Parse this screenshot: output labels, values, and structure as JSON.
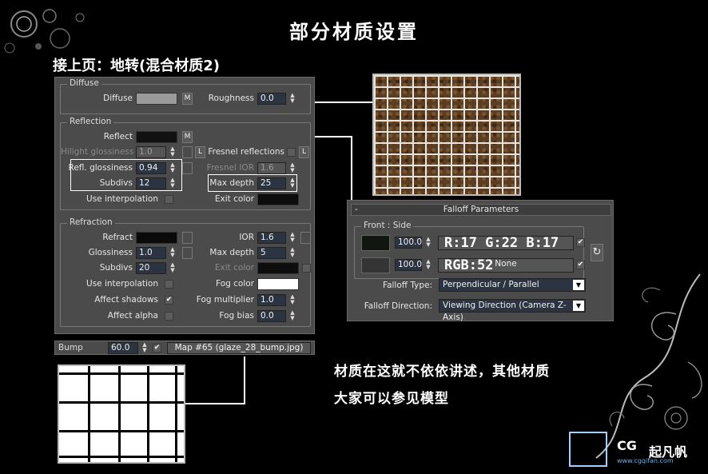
{
  "slide": {
    "title": "部分材质设置",
    "subtitle": "接上页：地转(混合材质2)"
  },
  "diffuse": {
    "group": "Diffuse",
    "diffuse_label": "Diffuse",
    "m_button": "M",
    "roughness_label": "Roughness",
    "roughness_value": "0.0"
  },
  "reflection": {
    "group": "Reflection",
    "reflect_label": "Reflect",
    "m_button": "M",
    "hilight_label": "Hilight glossiness",
    "hilight_value": "1.0",
    "l_button": "L",
    "fresnel_label": "Fresnel reflections",
    "fresnel_l": "L",
    "refl_gloss_label": "Refl. glossiness",
    "refl_gloss_value": "0.94",
    "fresnel_ior_label": "Fresnel IOR",
    "fresnel_ior_value": "1.6",
    "subdivs_label": "Subdivs",
    "subdivs_value": "12",
    "max_depth_label": "Max depth",
    "max_depth_value": "25",
    "use_interp_label": "Use interpolation",
    "exit_color_label": "Exit color"
  },
  "refraction": {
    "group": "Refraction",
    "refract_label": "Refract",
    "ior_label": "IOR",
    "ior_value": "1.6",
    "glossiness_label": "Glossiness",
    "glossiness_value": "1.0",
    "max_depth_label": "Max depth",
    "max_depth_value": "5",
    "subdivs_label": "Subdivs",
    "subdivs_value": "20",
    "exit_color_label": "Exit color",
    "use_interp_label": "Use interpolation",
    "fog_color_label": "Fog color",
    "affect_shadows_label": "Affect shadows",
    "affect_shadows_check": "✔",
    "fog_mult_label": "Fog multiplier",
    "fog_mult_value": "1.0",
    "affect_alpha_label": "Affect alpha",
    "fog_bias_label": "Fog bias",
    "fog_bias_value": "0.0"
  },
  "bump": {
    "label": "Bump",
    "value": "60.0",
    "check": "✔",
    "map": "Map #65 (glaze_28_bump.jpg)"
  },
  "falloff": {
    "title": "Falloff Parameters",
    "minus": "-",
    "group": "Front : Side",
    "front_value": "100.0",
    "side_value": "100.0",
    "side_map": "None",
    "check": "✔",
    "swap_icon": "↻",
    "type_label": "Falloff Type:",
    "type_value": "Perpendicular / Parallel",
    "dir_label": "Falloff Direction:",
    "dir_value": "Viewing Direction (Camera Z-Axis)",
    "rgb1": "R:17 G:22 B:17",
    "rgb2": "RGB:52"
  },
  "note": {
    "line1": "材质在这就不依依讲述，其他材质",
    "line2": "大家可以参见模型"
  },
  "watermark": {
    "brand": "CG",
    "brand2": "起凡帆",
    "url": "www.cgqifan.com"
  },
  "colors": {
    "panel_bg": "#4b4b4b",
    "spinner_bg": "#2b3440",
    "diffuse_swatch": "#9a9a9a",
    "reflect_swatch": "#111111",
    "exit_swatch": "#0d0d0d",
    "fog_swatch": "#ffffff",
    "front_color": "#111611",
    "side_color": "#343434"
  }
}
